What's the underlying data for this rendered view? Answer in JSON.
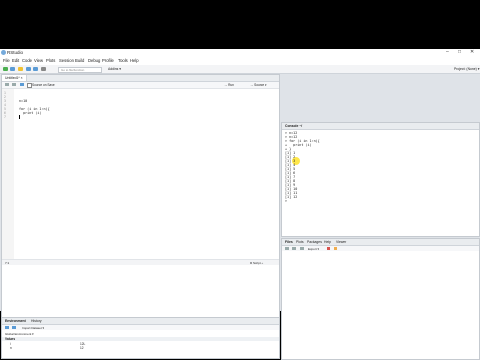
{
  "window": {
    "title": "RStudio",
    "controls": [
      "–",
      "□",
      "✕"
    ]
  },
  "menu": [
    "File",
    "Edit",
    "Code",
    "View",
    "Plots",
    "Session",
    "Build",
    "Debug",
    "Profile",
    "Tools",
    "Help"
  ],
  "toolbar": {
    "goto_placeholder": "Go to file/function",
    "addins": "Addins ▾",
    "project": "Project: (None) ▾"
  },
  "editor": {
    "tab": "Untitled1* ×",
    "tools": {
      "source_on_save": "Source on Save",
      "run": "→ Run",
      "source": "→ Source ▾"
    },
    "lines": [
      "",
      "",
      "n=10",
      "",
      "for (i in 1:n){",
      "  print (i)",
      ""
    ],
    "line_numbers": [
      "1",
      "2",
      "3",
      "4",
      "5",
      "6",
      "7"
    ],
    "status": "7:1",
    "status_right": "R Script ÷"
  },
  "environment": {
    "tabs": [
      "Environment",
      "History"
    ],
    "import": "Import Dataset ▾",
    "scope": "Global Environment ▾",
    "section": "Values",
    "rows": [
      {
        "name": "i",
        "value": "12L"
      },
      {
        "name": "n",
        "value": "12"
      }
    ]
  },
  "console": {
    "title": "Console  ~/",
    "lines": [
      "> n=12",
      "> n=12",
      "> for (i in 1:n){",
      "+   print (i)",
      "+ }",
      "[1] 1",
      "[1] 2",
      "[1] 3",
      "[1] 4",
      "[1] 5",
      "[1] 6",
      "[1] 7",
      "[1] 8",
      "[1] 9",
      "[1] 10",
      "[1] 11",
      "[1] 12",
      ">"
    ]
  },
  "files": {
    "tabs": [
      "Files",
      "Plots",
      "Packages",
      "Help",
      "Viewer"
    ],
    "tool": "Export ▾"
  }
}
